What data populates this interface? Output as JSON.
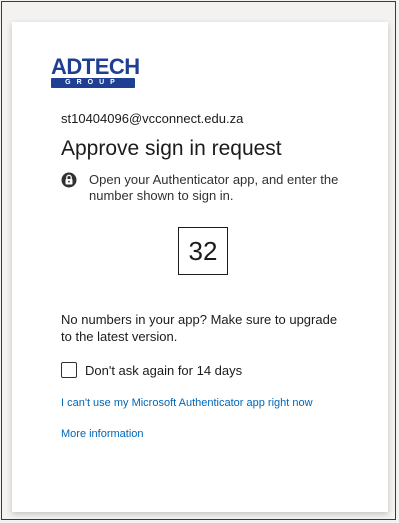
{
  "brand": {
    "logo_word": "ADTECH",
    "logo_sub": "GROUP",
    "color": "#1f3f93"
  },
  "account": {
    "email": "st10404096@vcconnect.edu.za"
  },
  "prompt": {
    "title": "Approve sign in request",
    "instruction": "Open your Authenticator app, and enter the number shown to sign in.",
    "instruction_icon": "lock-person-icon",
    "number": "32",
    "no_numbers_text": "No numbers in your app? Make sure to upgrade to the latest version."
  },
  "options": {
    "dont_ask_label": "Don't ask again for 14 days",
    "dont_ask_checked": false
  },
  "links": {
    "cant_use": "I can't use my Microsoft Authenticator app right now",
    "more_info": "More information",
    "color": "#0067b8"
  }
}
